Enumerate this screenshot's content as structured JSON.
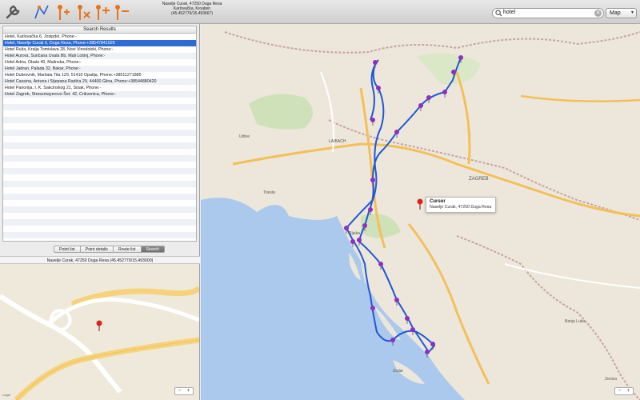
{
  "window": {
    "title_line1": "Naselje Curak, 47250 Duga Resa",
    "title_line2": "Karlovačka, Kroatien",
    "title_line3": "(45.452770/15.493667)"
  },
  "toolbar": {
    "buttons": [
      {
        "name": "wrench-icon"
      },
      {
        "name": "route-icon"
      },
      {
        "name": "add-point-icon"
      },
      {
        "name": "delete-point-icon"
      },
      {
        "name": "insert-point-icon"
      },
      {
        "name": "remove-point-icon"
      }
    ],
    "search_value": "hotel",
    "clear_glyph": "✕",
    "map_type": "Map"
  },
  "results": {
    "header": "Search Results",
    "rows": [
      "Hotel, Karlovačka 6, Josipdol, Phone:-",
      "Hotel, Naselje Curak 6, Duga Resa, Phone:+38547841526",
      "Hotel Ruža, Kralja Tomislava 28, Novi Vinodolski, Phone:-",
      "Hotel Aurora, Sunčana Uvala Bb, Mali Lošinj, Phone:-",
      "Hotel Adria, Obala 40, Malinska, Phone:-",
      "Hotel Jadran, Palada 32, Bakar, Phone:-",
      "Hotel Dubrovnik, Maršala Tita 129, 51410 Opatija, Phone:+38511271885",
      "Hotel Cassina, Antuna i Stjepana Radića 29, 44400 Glina, Phone:+38544880420",
      "Hotel Panonija, I. K. Sakcinskog 21, Sisak, Phone:-",
      "Hotel Zagreb, Strossmayerovo Šet. 42, Crikvenica, Phone:-"
    ],
    "selected_index": 1
  },
  "tabs": [
    "Point list",
    "Point details",
    "Route list",
    "Search"
  ],
  "active_tab": 3,
  "detail": {
    "title": "Naselje Curak, 47250 Duga Resa (45.452770/15.493000)",
    "legal": "Legal"
  },
  "zoom": {
    "minus": "−",
    "plus": "+"
  },
  "map": {
    "cursor_title": "Cursor",
    "cursor_sub": "Naselje Curak, 47250 Duga Resa",
    "labels": {
      "zagreb": "ZAGREB",
      "trieste": "Trieste",
      "rijeka": "Rijeka",
      "zadar": "Zadar",
      "banja_luka": "Banja Luka",
      "laibach": "LAIBACH",
      "udine": "Udine",
      "zenica": "Zenica"
    },
    "colors": {
      "route": "#1f57d6",
      "pin": "#8e2fc4",
      "cursor_pin": "#d8241c",
      "sea": "#aac9ec",
      "land": "#ece7da",
      "park": "#cfe1b8"
    }
  }
}
